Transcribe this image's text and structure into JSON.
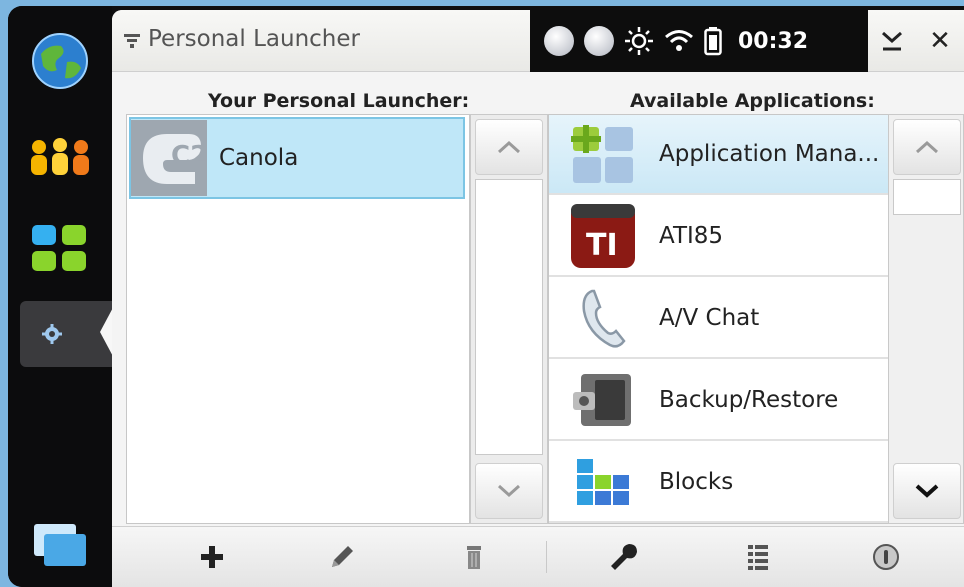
{
  "window": {
    "title": "Personal Launcher",
    "close_glyph": "✕",
    "minimize_glyph": "⤓"
  },
  "status_bar": {
    "clock": "00:32",
    "icons": [
      "presence-icon",
      "presence-icon",
      "brightness-icon",
      "wifi-icon",
      "battery-icon"
    ]
  },
  "dock": {
    "items": [
      {
        "name": "web-globe-icon"
      },
      {
        "name": "contacts-icon"
      },
      {
        "name": "applications-icon"
      },
      {
        "name": "settings-gear-icon",
        "active": true
      },
      {
        "name": "task-switcher-icon"
      }
    ]
  },
  "launcher": {
    "heading": "Your Personal Launcher:",
    "items": [
      {
        "label": "Canola",
        "icon": "canola-icon",
        "selected": true
      }
    ]
  },
  "available": {
    "heading": "Available Applications:",
    "items": [
      {
        "label": "Application Mana...",
        "icon": "application-manager-icon"
      },
      {
        "label": "ATI85",
        "icon": "ati85-icon"
      },
      {
        "label": "A/V Chat",
        "icon": "phone-icon"
      },
      {
        "label": "Backup/Restore",
        "icon": "backup-icon"
      },
      {
        "label": "Blocks",
        "icon": "blocks-icon"
      }
    ]
  },
  "toolbar": {
    "tools": [
      "add-icon",
      "edit-pencil-icon",
      "delete-trash-icon",
      "settings-wrench-icon",
      "list-icon",
      "info-icon"
    ]
  },
  "colors": {
    "selection": "#bfe7f8",
    "selection_border": "#7cc5e4",
    "ati85_red": "#8b1a14"
  },
  "icon_text": {
    "ati85": "TI",
    "canola": "C2"
  }
}
